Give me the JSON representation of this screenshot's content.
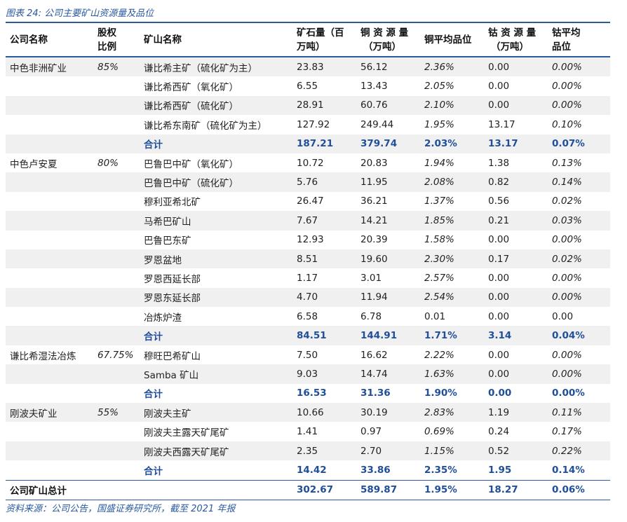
{
  "caption": "图表 24:  公司主要矿山资源量及品位",
  "headers": {
    "company": "公司名称",
    "ratio_l1": "股权",
    "ratio_l2": "比例",
    "mine": "矿山名称",
    "ore_l1": "矿石量（百",
    "ore_l2": "万吨）",
    "cu_l1": "铜 资 源 量",
    "cu_l2": "（万吨）",
    "cu_grade": "铜平均品位",
    "co_l1": "钴 资 源 量",
    "co_l2": "（万吨）",
    "co_grade_l1": "钴平均",
    "co_grade_l2": "品位"
  },
  "rows": [
    {
      "company": "中色非洲矿业",
      "ratio": "85%",
      "mine": "谦比希主矿（硫化矿为主）",
      "ore": "23.83",
      "cu": "56.12",
      "cu_grade": "2.36%",
      "co": "0.00",
      "co_grade": "0.00%",
      "type": "shade"
    },
    {
      "company": "",
      "ratio": "",
      "mine": "谦比希西矿（氧化矿）",
      "ore": "6.55",
      "cu": "13.43",
      "cu_grade": "2.05%",
      "co": "0.00",
      "co_grade": "0.00%",
      "type": "plain"
    },
    {
      "company": "",
      "ratio": "",
      "mine": "谦比希西矿（硫化矿）",
      "ore": "28.91",
      "cu": "60.76",
      "cu_grade": "2.10%",
      "co": "0.00",
      "co_grade": "0.00%",
      "type": "shade"
    },
    {
      "company": "",
      "ratio": "",
      "mine": "谦比希东南矿（硫化矿为主）",
      "ore": "127.92",
      "cu": "249.44",
      "cu_grade": "1.95%",
      "co": "13.17",
      "co_grade": "0.10%",
      "type": "plain"
    },
    {
      "company": "",
      "ratio": "",
      "mine": "合计",
      "ore": "187.21",
      "cu": "379.74",
      "cu_grade": "2.03%",
      "co": "13.17",
      "co_grade": "0.07%",
      "type": "sum-shade"
    },
    {
      "company": "中色卢安夏",
      "ratio": "80%",
      "mine": "巴鲁巴中矿（氧化矿）",
      "ore": "10.72",
      "cu": "20.83",
      "cu_grade": "1.94%",
      "co": "1.38",
      "co_grade": "0.13%",
      "type": "plain"
    },
    {
      "company": "",
      "ratio": "",
      "mine": "巴鲁巴中矿（硫化矿）",
      "ore": "5.76",
      "cu": "11.95",
      "cu_grade": "2.08%",
      "co": "0.82",
      "co_grade": "0.14%",
      "type": "shade"
    },
    {
      "company": "",
      "ratio": "",
      "mine": "穆利亚希北矿",
      "ore": "26.47",
      "cu": "36.21",
      "cu_grade": "1.37%",
      "co": "0.56",
      "co_grade": "0.02%",
      "type": "plain"
    },
    {
      "company": "",
      "ratio": "",
      "mine": "马希巴矿山",
      "ore": "7.67",
      "cu": "14.21",
      "cu_grade": "1.85%",
      "co": "0.21",
      "co_grade": "0.03%",
      "type": "shade"
    },
    {
      "company": "",
      "ratio": "",
      "mine": "巴鲁巴东矿",
      "ore": "12.93",
      "cu": "20.39",
      "cu_grade": "1.58%",
      "co": "0.00",
      "co_grade": "0.00%",
      "type": "plain"
    },
    {
      "company": "",
      "ratio": "",
      "mine": "罗恩盆地",
      "ore": "8.51",
      "cu": "19.60",
      "cu_grade": "2.30%",
      "co": "0.17",
      "co_grade": "0.02%",
      "type": "shade"
    },
    {
      "company": "",
      "ratio": "",
      "mine": "罗恩西延长部",
      "ore": "1.17",
      "cu": "3.01",
      "cu_grade": "2.57%",
      "co": "0.00",
      "co_grade": "0.00%",
      "type": "plain"
    },
    {
      "company": "",
      "ratio": "",
      "mine": "罗恩东延长部",
      "ore": "4.70",
      "cu": "11.94",
      "cu_grade": "2.54%",
      "co": "0.00",
      "co_grade": "0.00%",
      "type": "shade"
    },
    {
      "company": "",
      "ratio": "",
      "mine": "冶炼炉渣",
      "ore": "6.58",
      "cu": "6.78",
      "cu_grade": "0.01",
      "co": "0.00",
      "co_grade": "0.00",
      "type": "plain-noitalic"
    },
    {
      "company": "",
      "ratio": "",
      "mine": "合计",
      "ore": "84.51",
      "cu": "144.91",
      "cu_grade": "1.71%",
      "co": "3.14",
      "co_grade": "0.04%",
      "type": "sum-shade"
    },
    {
      "company": "谦比希湿法冶炼",
      "ratio": "67.75%",
      "mine": "穆旺巴希矿山",
      "ore": "7.50",
      "cu": "16.62",
      "cu_grade": "2.22%",
      "co": "0.00",
      "co_grade": "0.00%",
      "type": "plain"
    },
    {
      "company": "",
      "ratio": "",
      "mine": "Samba 矿山",
      "ore": "9.03",
      "cu": "14.74",
      "cu_grade": "1.63%",
      "co": "0.00",
      "co_grade": "0.00%",
      "type": "shade"
    },
    {
      "company": "",
      "ratio": "",
      "mine": "合计",
      "ore": "16.53",
      "cu": "31.36",
      "cu_grade": "1.90%",
      "co": "0.00",
      "co_grade": "0.00%",
      "type": "sum"
    },
    {
      "company": "刚波夫矿业",
      "ratio": "55%",
      "mine": "刚波夫主矿",
      "ore": "10.66",
      "cu": "30.19",
      "cu_grade": "2.83%",
      "co": "1.19",
      "co_grade": "0.11%",
      "type": "shade"
    },
    {
      "company": "",
      "ratio": "",
      "mine": "刚波夫主露天矿尾矿",
      "ore": "1.41",
      "cu": "0.97",
      "cu_grade": "0.69%",
      "co": "0.24",
      "co_grade": "0.17%",
      "type": "plain"
    },
    {
      "company": "",
      "ratio": "",
      "mine": "刚波夫西露天矿尾矿",
      "ore": "2.35",
      "cu": "2.70",
      "cu_grade": "1.15%",
      "co": "0.52",
      "co_grade": "0.22%",
      "type": "shade"
    },
    {
      "company": "",
      "ratio": "",
      "mine": "合计",
      "ore": "14.42",
      "cu": "33.86",
      "cu_grade": "2.35%",
      "co": "1.95",
      "co_grade": "0.14%",
      "type": "sum"
    }
  ],
  "grand_total": {
    "label": "公司矿山总计",
    "ore": "302.67",
    "cu": "589.87",
    "cu_grade": "1.95%",
    "co": "18.27",
    "co_grade": "0.06%"
  },
  "footer": "资料来源：公司公告，国盛证券研究所，截至 2021 年报",
  "colors": {
    "accent": "#2a5aa0",
    "total_text": "#1f4e9a",
    "shade": "#f0f0f0"
  }
}
